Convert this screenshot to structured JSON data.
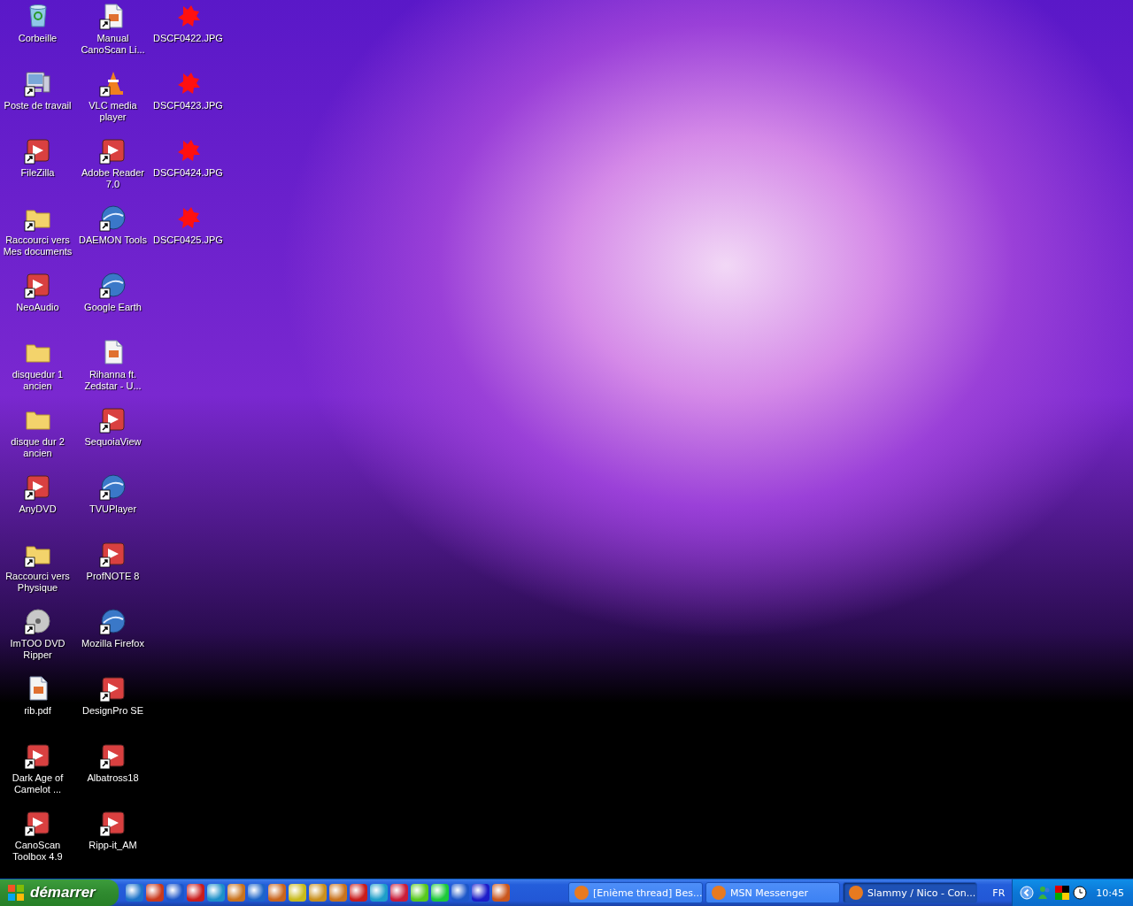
{
  "desktop": {
    "icons": [
      {
        "label": "Corbeille",
        "kind": "bin",
        "shortcut": false
      },
      {
        "label": "Poste de travail",
        "kind": "computer",
        "shortcut": true
      },
      {
        "label": "FileZilla",
        "kind": "app",
        "shortcut": true
      },
      {
        "label": "Raccourci vers Mes documents",
        "kind": "folder",
        "shortcut": true
      },
      {
        "label": "NeoAudio",
        "kind": "app",
        "shortcut": true
      },
      {
        "label": "disquedur 1 ancien",
        "kind": "folder",
        "shortcut": false
      },
      {
        "label": "disque dur 2 ancien",
        "kind": "folder",
        "shortcut": false
      },
      {
        "label": "AnyDVD",
        "kind": "app",
        "shortcut": true
      },
      {
        "label": "Raccourci vers Physique",
        "kind": "folder",
        "shortcut": true
      },
      {
        "label": "ImTOO DVD Ripper",
        "kind": "disc",
        "shortcut": true
      },
      {
        "label": "rib.pdf",
        "kind": "document",
        "shortcut": false
      },
      {
        "label": "Dark Age of Camelot ...",
        "kind": "app",
        "shortcut": true
      },
      {
        "label": "CanoScan Toolbox 4.9",
        "kind": "app",
        "shortcut": true
      },
      {
        "label": "Manual CanoScan Li...",
        "kind": "document",
        "shortcut": true
      },
      {
        "label": "VLC media player",
        "kind": "cone",
        "shortcut": true
      },
      {
        "label": "Adobe Reader 7.0",
        "kind": "app",
        "shortcut": true
      },
      {
        "label": "DAEMON Tools",
        "kind": "globe",
        "shortcut": true
      },
      {
        "label": "Google Earth",
        "kind": "globe",
        "shortcut": true
      },
      {
        "label": "Rihanna ft. Zedstar - U...",
        "kind": "document",
        "shortcut": false
      },
      {
        "label": "SequoiaView",
        "kind": "app",
        "shortcut": true
      },
      {
        "label": "TVUPlayer",
        "kind": "globe",
        "shortcut": true
      },
      {
        "label": "ProfNOTE 8",
        "kind": "app",
        "shortcut": true
      },
      {
        "label": "Mozilla Firefox",
        "kind": "globe",
        "shortcut": true
      },
      {
        "label": "DesignPro SE",
        "kind": "app",
        "shortcut": true
      },
      {
        "label": "Albatross18",
        "kind": "app",
        "shortcut": true
      },
      {
        "label": "Ripp-it_AM",
        "kind": "app",
        "shortcut": true
      },
      {
        "label": "DSCF0422.JPG",
        "kind": "image",
        "shortcut": false
      },
      {
        "label": "DSCF0423.JPG",
        "kind": "image",
        "shortcut": false
      },
      {
        "label": "DSCF0424.JPG",
        "kind": "image",
        "shortcut": false
      },
      {
        "label": "DSCF0425.JPG",
        "kind": "image",
        "shortcut": false
      }
    ]
  },
  "taskbar": {
    "start_label": "démarrer",
    "tasks": [
      {
        "label": "[Enième thread] Bes...",
        "selected": false
      },
      {
        "label": "MSN Messenger",
        "selected": false
      },
      {
        "label": "Slammy / Nico - Con...",
        "selected": true
      }
    ],
    "language": "FR",
    "clock": "10:45"
  }
}
